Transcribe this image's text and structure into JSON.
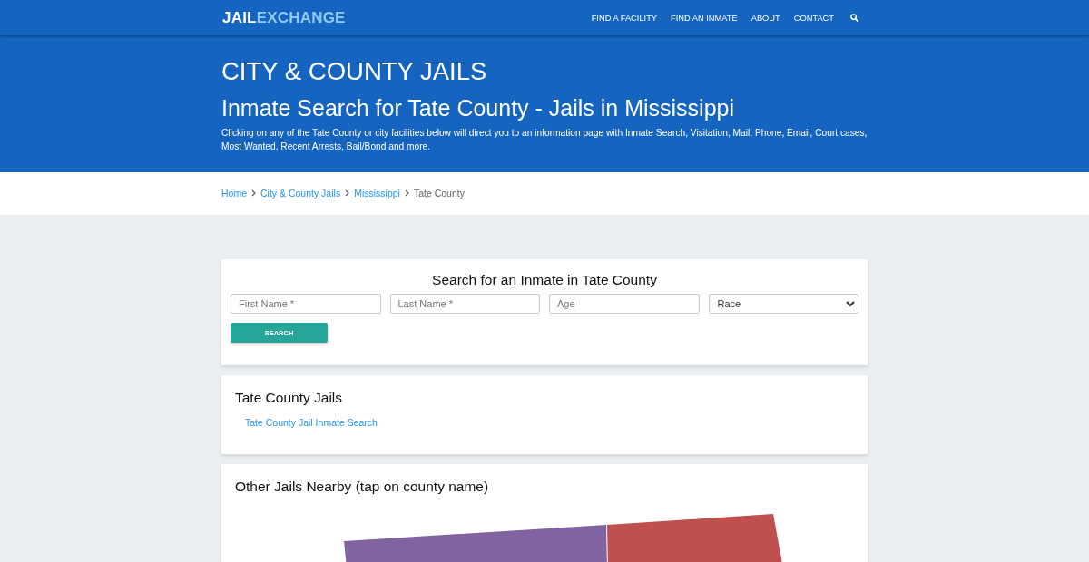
{
  "header": {
    "logo": {
      "part_1": "JAIL",
      "part_2": "EXCHANGE"
    },
    "nav": [
      "FIND A FACILITY",
      "FIND AN INMATE",
      "ABOUT",
      "CONTACT"
    ]
  },
  "hero": {
    "section": "CITY & COUNTY JAILS",
    "title": "Inmate Search for Tate County - Jails in Mississippi",
    "description": "Clicking on any of the Tate County or city facilities below will direct you to an information page with Inmate Search, Visitation, Mail, Phone, Email, Court cases, Most Wanted, Recent Arrests, Bail/Bond and more."
  },
  "breadcrumb": [
    {
      "label": "Home",
      "current": false
    },
    {
      "label": "City & County Jails",
      "current": false
    },
    {
      "label": "Mississippi",
      "current": false
    },
    {
      "label": "Tate County",
      "current": true
    }
  ],
  "search_form": {
    "title": "Search for an Inmate in Tate County",
    "fields": [
      {
        "kind": "text",
        "placeholder": "First Name *"
      },
      {
        "kind": "text",
        "placeholder": "Last Name *"
      },
      {
        "kind": "text",
        "placeholder": "Age"
      },
      {
        "kind": "select",
        "value": "Race"
      }
    ],
    "button": "SEARCH"
  },
  "jails": {
    "title": "Tate County Jails",
    "links": [
      "Tate County Jail Inmate Search"
    ]
  },
  "nearby": {
    "title": "Other Jails Nearby (tap on county name)"
  }
}
